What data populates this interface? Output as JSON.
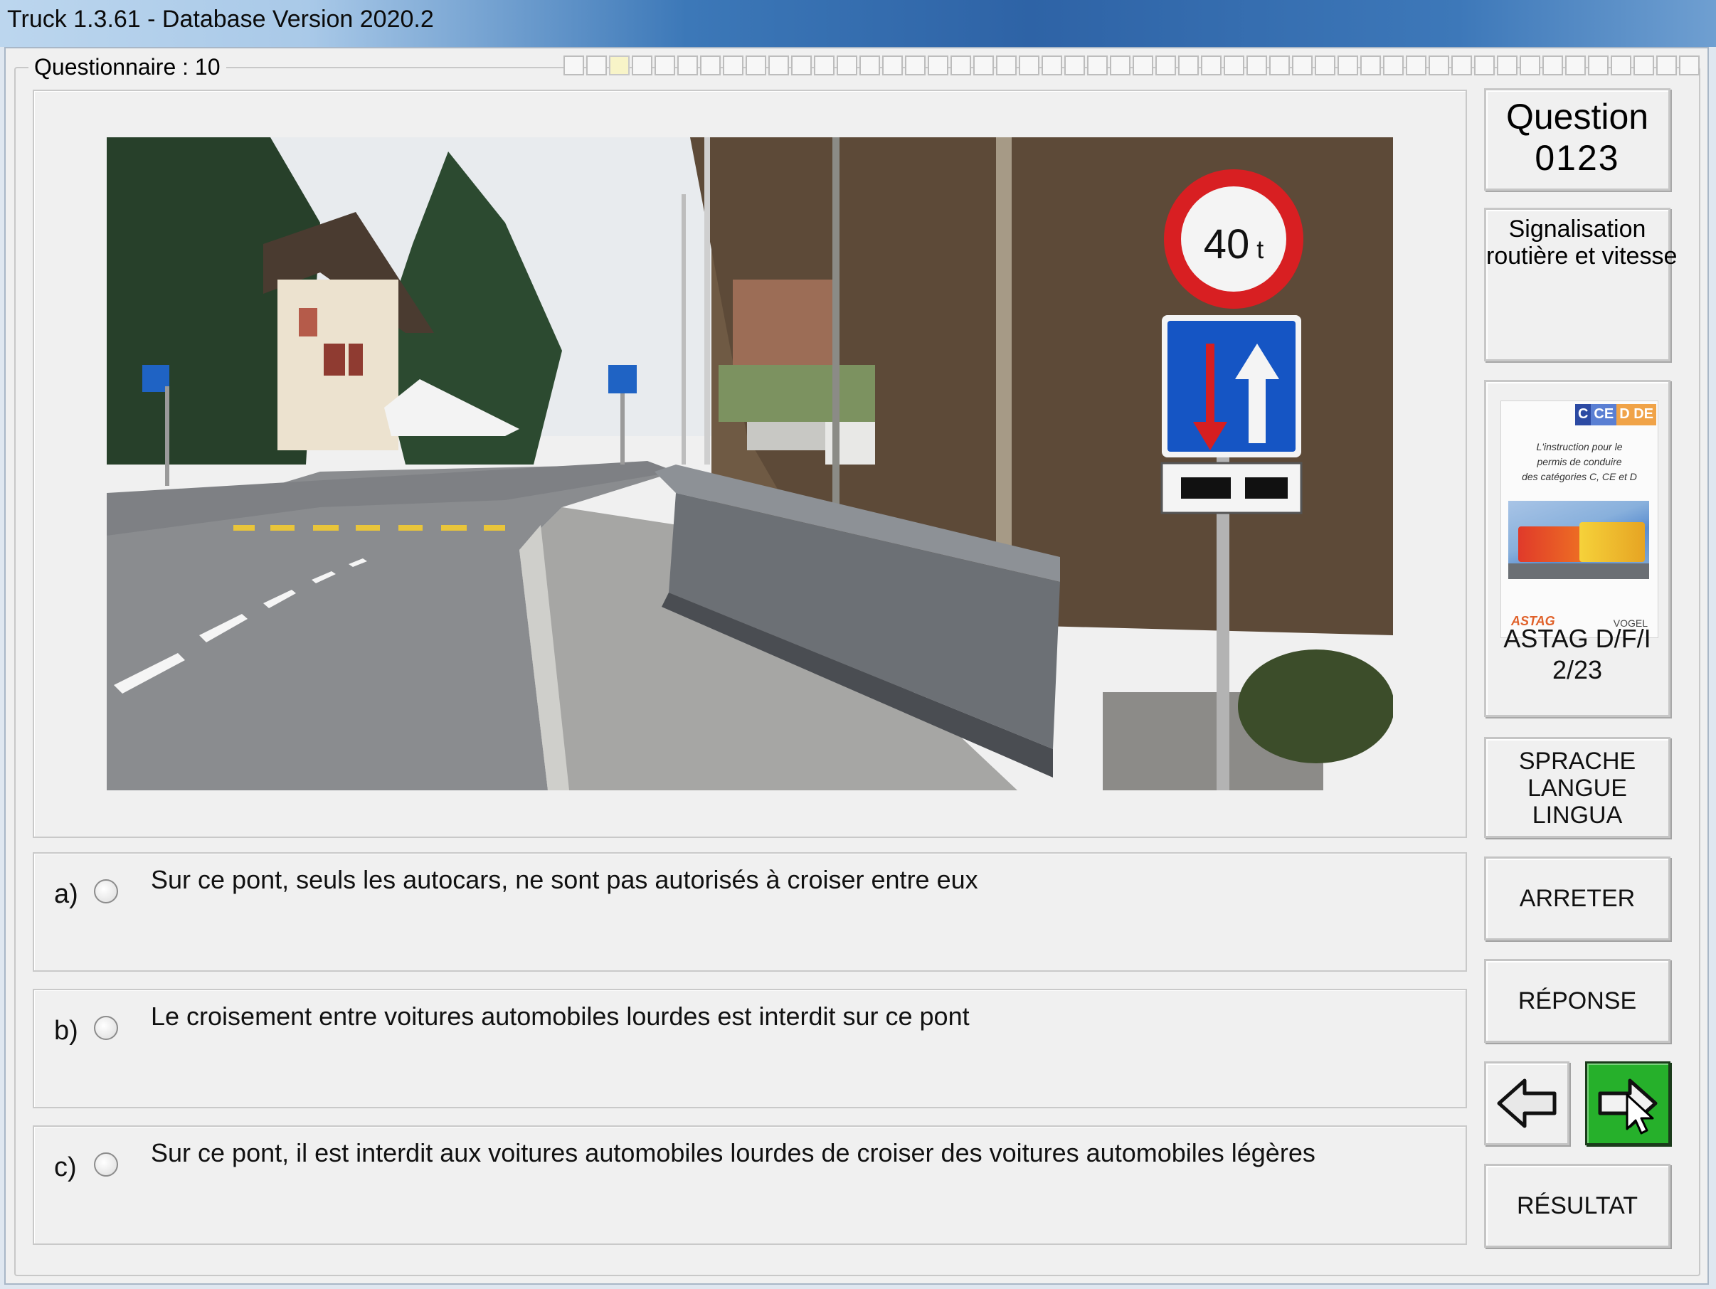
{
  "window": {
    "title": "Truck 1.3.61 - Database Version 2020.2"
  },
  "group": {
    "label": "Questionnaire : 10",
    "progress_cells": 50,
    "current_cell": 2
  },
  "question": {
    "label": "Question",
    "number": "0123",
    "category_line1": "Signalisation",
    "category_line2": "routière et vitesse",
    "sign": {
      "weight_label": "40",
      "weight_unit": "t"
    }
  },
  "answers": [
    {
      "letter": "a)",
      "text": "Sur ce pont, seuls les autocars, ne sont pas autorisés à croiser entre eux",
      "selected": false
    },
    {
      "letter": "b)",
      "text": "Le croisement entre voitures automobiles lourdes est interdit sur ce pont",
      "selected": false
    },
    {
      "letter": "c)",
      "text": "Sur ce pont, il est interdit aux voitures automobiles lourdes de croiser des voitures automobiles légères",
      "selected": false
    }
  ],
  "book": {
    "tag1": "C",
    "tag2": "CE",
    "tag3": "D DE",
    "caption1": "L'instruction pour le",
    "caption2": "permis de conduire",
    "caption3": "des catégories C, CE et D",
    "publisher_left": "ASTAG",
    "publisher_right": "VOGEL",
    "title": "ASTAG D/F/I",
    "edition": "2/23"
  },
  "buttons": {
    "lang1": "SPRACHE",
    "lang2": "LANGUE",
    "lang3": "LINGUA",
    "stop": "ARRETER",
    "answer": "RÉPONSE",
    "result": "RÉSULTAT"
  },
  "icons": {
    "prev": "arrow-left-icon",
    "next": "arrow-right-icon",
    "cursor": "mouse-pointer-icon"
  },
  "colors": {
    "next_button": "#26b02b",
    "titlebar": "#2e63a6"
  }
}
